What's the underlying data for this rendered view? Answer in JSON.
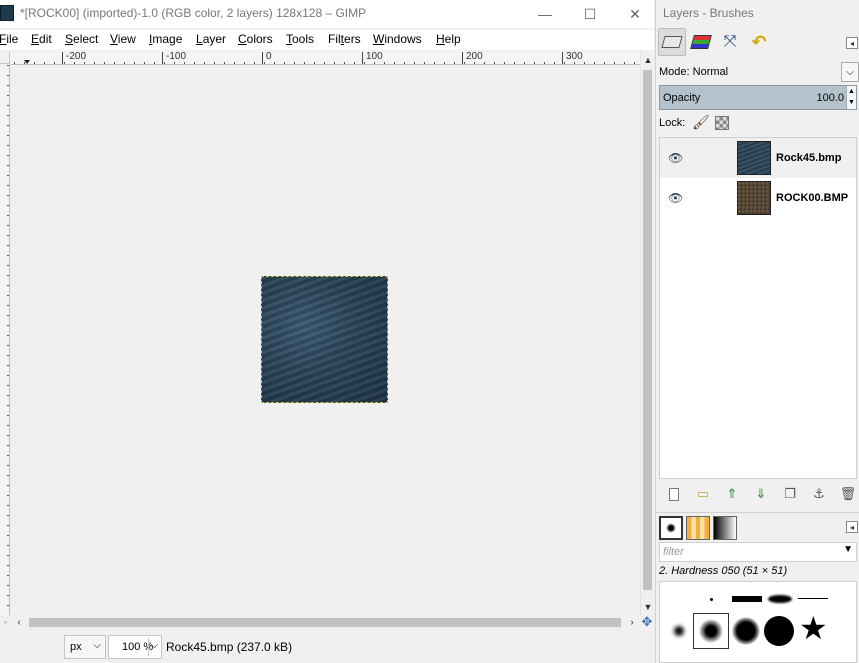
{
  "window": {
    "title": "*[ROCK00] (imported)-1.0 (RGB color, 2 layers) 128x128 – GIMP",
    "min_glyph": "—",
    "max_glyph": "☐",
    "close_glyph": "✕"
  },
  "menu": [
    {
      "label": "File",
      "u": "F",
      "rest": "ile"
    },
    {
      "label": "Edit",
      "u": "E",
      "rest": "dit"
    },
    {
      "label": "Select",
      "u": "S",
      "rest": "elect"
    },
    {
      "label": "View",
      "u": "V",
      "rest": "iew"
    },
    {
      "label": "Image",
      "u": "I",
      "rest": "mage"
    },
    {
      "label": "Layer",
      "u": "L",
      "rest": "ayer"
    },
    {
      "label": "Colors",
      "u": "C",
      "rest": "olors"
    },
    {
      "label": "Tools",
      "u": "T",
      "rest": "ools"
    },
    {
      "label": "Filters",
      "u": "F",
      "rest": "ilters",
      "underline_index": 3
    },
    {
      "label": "Windows",
      "u": "W",
      "rest": "indows"
    },
    {
      "label": "Help",
      "u": "H",
      "rest": "elp"
    }
  ],
  "ruler": {
    "labels": [
      "-200",
      "-100",
      "0",
      "100",
      "200",
      "300"
    ]
  },
  "status": {
    "unit": "px",
    "zoom": "100 %",
    "message": "Rock45.bmp (237.0 kB)"
  },
  "dock": {
    "title": "Layers - Brushes",
    "tab_icons": [
      "layers-icon",
      "channels-icon",
      "paths-icon",
      "undo-history-icon"
    ],
    "mode_label": "Mode:",
    "mode_value": "Normal",
    "opacity_label": "Opacity",
    "opacity_value": "100.0",
    "lock_label": "Lock:",
    "layers": [
      {
        "name": "Rock45.bmp",
        "thumb_color": "#2a4358",
        "visible": true,
        "active": true
      },
      {
        "name": "ROCK00.BMP",
        "thumb_color": "#4a3b2c",
        "visible": true,
        "active": false
      }
    ],
    "filter_placeholder": "filter",
    "brush_name": "2. Hardness 050 (51 × 51)"
  },
  "colors": {
    "selection_marching_ants": "#c7c23a",
    "opacity_bar": "#b4c2cc",
    "rock45_thumb": "#2a4358",
    "rock00_thumb": "#4a3b2c"
  }
}
